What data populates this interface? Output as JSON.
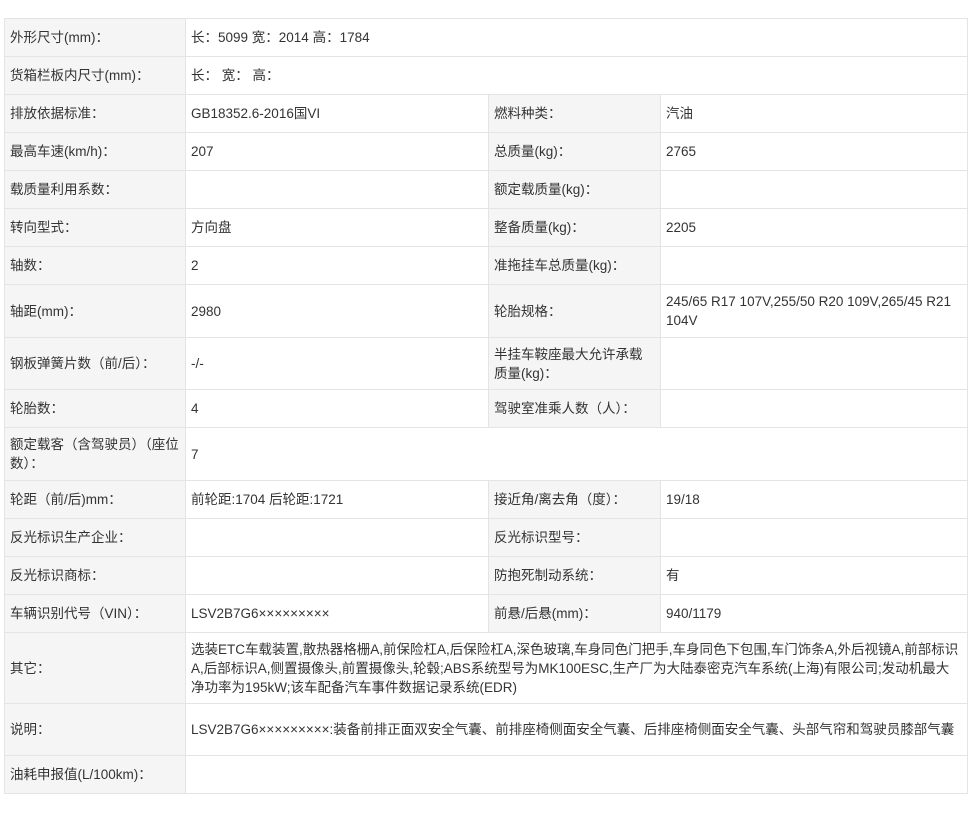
{
  "rows": [
    {
      "label": "外形尺寸(mm)：",
      "value": "长：5099 宽：2014 高：1784"
    },
    {
      "label": "货箱栏板内尺寸(mm)：",
      "value": "长： 宽： 高："
    },
    {
      "label": "排放依据标准：",
      "value": "GB18352.6-2016国VI",
      "label2": "燃料种类：",
      "value2": "汽油"
    },
    {
      "label": "最高车速(km/h)：",
      "value": "207",
      "label2": "总质量(kg)：",
      "value2": "2765"
    },
    {
      "label": "载质量利用系数：",
      "value": "",
      "label2": "额定载质量(kg)：",
      "value2": ""
    },
    {
      "label": "转向型式：",
      "value": "方向盘",
      "label2": "整备质量(kg)：",
      "value2": "2205"
    },
    {
      "label": "轴数：",
      "value": "2",
      "label2": "准拖挂车总质量(kg)：",
      "value2": ""
    },
    {
      "label": "轴距(mm)：",
      "value": "2980",
      "label2": "轮胎规格：",
      "value2": "245/65 R17 107V,255/50 R20 109V,265/45 R21 104V"
    },
    {
      "label": "钢板弹簧片数（前/后）：",
      "value": "-/-",
      "label2": "半挂车鞍座最大允许承载质量(kg)：",
      "value2": ""
    },
    {
      "label": "轮胎数：",
      "value": "4",
      "label2": "驾驶室准乘人数（人）：",
      "value2": ""
    },
    {
      "label": "额定载客（含驾驶员）（座位数）：",
      "value": "7"
    },
    {
      "label": "轮距（前/后)mm：",
      "value": "前轮距:1704 后轮距:1721",
      "label2": "接近角/离去角（度）：",
      "value2": "19/18"
    },
    {
      "label": "反光标识生产企业：",
      "value": "",
      "label2": "反光标识型号：",
      "value2": ""
    },
    {
      "label": "反光标识商标：",
      "value": "",
      "label2": "防抱死制动系统：",
      "value2": "有"
    },
    {
      "label": "车辆识别代号（VIN）：",
      "value": "LSV2B7G6×××××××××",
      "label2": "前悬/后悬(mm)：",
      "value2": "940/1179"
    },
    {
      "label": "其它：",
      "value": "选装ETC车载装置,散热器格栅A,前保险杠A,后保险杠A,深色玻璃,车身同色门把手,车身同色下包围,车门饰条A,外后视镜A,前部标识A,后部标识A,侧置摄像头,前置摄像头,轮毂;ABS系统型号为MK100ESC,生产厂为大陆泰密克汽车系统(上海)有限公司;发动机最大净功率为195kW;该车配备汽车事件数据记录系统(EDR)"
    },
    {
      "label": "说明：",
      "value": "LSV2B7G6×××××××××:装备前排正面双安全气囊、前排座椅侧面安全气囊、后排座椅侧面安全气囊、头部气帘和驾驶员膝部气囊"
    },
    {
      "label": "油耗申报值(L/100km)：",
      "value": ""
    }
  ]
}
